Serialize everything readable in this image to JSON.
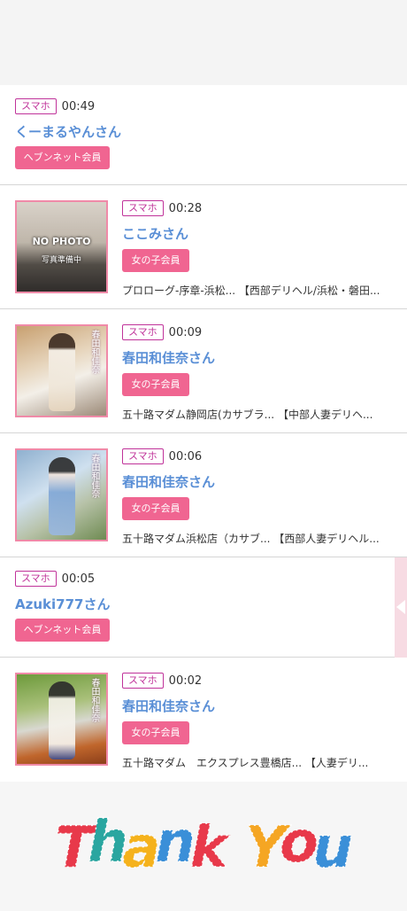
{
  "entries": [
    {
      "badge": "スマホ",
      "time": "00:49",
      "name": "くーまるやんさん",
      "member": "ヘブンネット会員"
    },
    {
      "badge": "スマホ",
      "time": "00:28",
      "name": "ここみさん",
      "member": "女の子会員",
      "shop": "プロローグ-序章-浜松... 【西部デリヘル/浜松・磐田...",
      "photo_text": "NO PHOTO",
      "photo_sub": "写真準備中"
    },
    {
      "badge": "スマホ",
      "time": "00:09",
      "name": "春田和佳奈さん",
      "member": "女の子会員",
      "shop": "五十路マダム静岡店(カサブラ... 【中部人妻デリヘ...",
      "photo_caption": "春田和佳奈"
    },
    {
      "badge": "スマホ",
      "time": "00:06",
      "name": "春田和佳奈さん",
      "member": "女の子会員",
      "shop": "五十路マダム浜松店（カサブ... 【西部人妻デリヘル...",
      "photo_caption": "春田和佳奈"
    },
    {
      "badge": "スマホ",
      "time": "00:05",
      "name": "Azuki777さん",
      "member": "ヘブンネット会員"
    },
    {
      "badge": "スマホ",
      "time": "00:02",
      "name": "春田和佳奈さん",
      "member": "女の子会員",
      "shop": "五十路マダム　エクスプレス豊橋店... 【人妻デリ...",
      "photo_caption": "春田和佳奈"
    }
  ],
  "thanks_text": "Thank You",
  "colors": {
    "badge": "#c0339a",
    "name": "#5a8fd6",
    "member_button": "#f06591",
    "thumb_border": "#f08aa8"
  }
}
